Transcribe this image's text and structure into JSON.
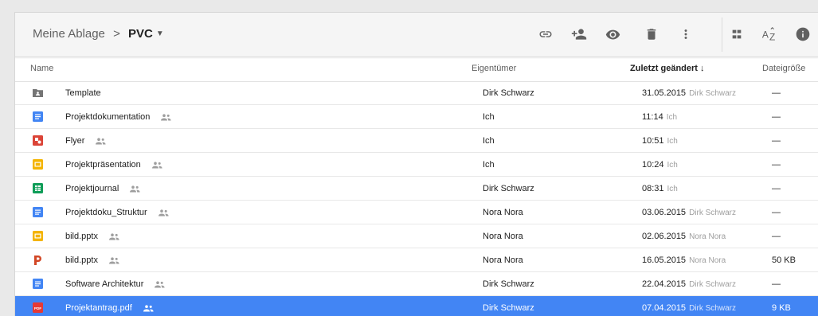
{
  "toolbar": {
    "breadcrumb_root": "Meine Ablage",
    "breadcrumb_separator": ">",
    "breadcrumb_current": "PVC",
    "icons": [
      "link-icon",
      "add-person-icon",
      "eye-icon",
      "trash-icon",
      "more-vert-icon",
      "grid-view-icon",
      "sort-az-icon",
      "info-icon"
    ]
  },
  "columns": {
    "name": "Name",
    "owner": "Eigentümer",
    "modified": "Zuletzt geändert ↓",
    "size": "Dateigröße"
  },
  "files": [
    {
      "name": "Template",
      "type": "shared-folder",
      "shared": false,
      "owner": "Dirk Schwarz",
      "modified": "31.05.2015",
      "modified_by": "Dirk Schwarz",
      "size": "—",
      "selected": false
    },
    {
      "name": "Projektdokumentation",
      "type": "docs",
      "shared": true,
      "owner": "Ich",
      "modified": "11:14",
      "modified_by": "Ich",
      "size": "—",
      "selected": false
    },
    {
      "name": "Flyer",
      "type": "drawing",
      "shared": true,
      "owner": "Ich",
      "modified": "10:51",
      "modified_by": "Ich",
      "size": "—",
      "selected": false
    },
    {
      "name": "Projektpräsentation",
      "type": "slides",
      "shared": true,
      "owner": "Ich",
      "modified": "10:24",
      "modified_by": "Ich",
      "size": "—",
      "selected": false
    },
    {
      "name": "Projektjournal",
      "type": "sheets",
      "shared": true,
      "owner": "Dirk Schwarz",
      "modified": "08:31",
      "modified_by": "Ich",
      "size": "—",
      "selected": false
    },
    {
      "name": "Projektdoku_Struktur",
      "type": "docs",
      "shared": true,
      "owner": "Nora Nora",
      "modified": "03.06.2015",
      "modified_by": "Dirk Schwarz",
      "size": "—",
      "selected": false
    },
    {
      "name": "bild.pptx",
      "type": "slides",
      "shared": true,
      "owner": "Nora Nora",
      "modified": "02.06.2015",
      "modified_by": "Nora Nora",
      "size": "—",
      "selected": false
    },
    {
      "name": "bild.pptx",
      "type": "powerpoint",
      "shared": true,
      "owner": "Nora Nora",
      "modified": "16.05.2015",
      "modified_by": "Nora Nora",
      "size": "50 KB",
      "selected": false
    },
    {
      "name": "Software Architektur",
      "type": "docs",
      "shared": true,
      "owner": "Dirk Schwarz",
      "modified": "22.04.2015",
      "modified_by": "Dirk Schwarz",
      "size": "—",
      "selected": false
    },
    {
      "name": "Projektantrag.pdf",
      "type": "pdf",
      "shared": true,
      "owner": "Dirk Schwarz",
      "modified": "07.04.2015",
      "modified_by": "Dirk Schwarz",
      "size": "9 KB",
      "selected": true
    }
  ],
  "colors": {
    "docs": "#4285f4",
    "drawing": "#db4437",
    "slides": "#f4b400",
    "sheets": "#0f9d58",
    "folder": "#757575",
    "powerpoint": "#d24726",
    "pdf": "#e53935",
    "selection": "#4285f4"
  }
}
